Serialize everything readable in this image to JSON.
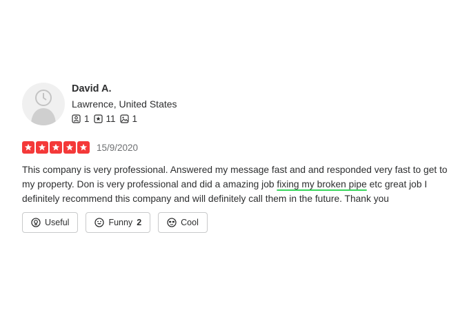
{
  "reviewer": {
    "name": "David A.",
    "location": "Lawrence, United States",
    "stats": {
      "friends": "1",
      "reviews": "11",
      "photos": "1"
    }
  },
  "review": {
    "rating": 5,
    "rating_max": 5,
    "date": "15/9/2020",
    "text_part1": "This company is very professional. Answered my message fast and and responded very fast to get to my property. Don is very professional and did a amazing job ",
    "text_highlight": "fixing my broken pipe",
    "text_part2": " etc great job I definitely recommend this company and will definitely call them in the future. Thank you"
  },
  "reactions": {
    "useful_label": "Useful",
    "funny_label": "Funny",
    "funny_count": "2",
    "cool_label": "Cool"
  },
  "colors": {
    "star": "#f43939",
    "highlight_underline": "#35d65a"
  },
  "icons": {
    "friends": "friends-icon",
    "reviews": "star-outline-icon",
    "photos": "photo-icon",
    "useful": "lightbulb-icon",
    "funny": "smile-icon",
    "cool": "sunglasses-icon"
  }
}
